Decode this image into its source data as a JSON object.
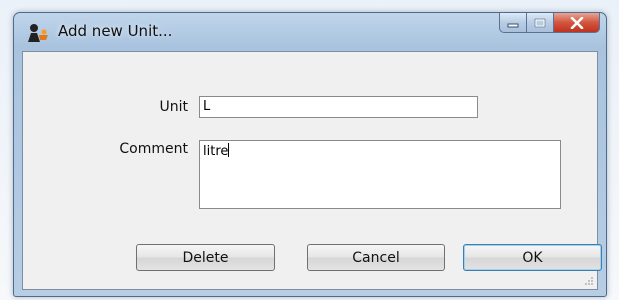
{
  "window": {
    "title": "Add new Unit..."
  },
  "form": {
    "unit_label": "Unit",
    "unit_value": "L",
    "comment_label": "Comment",
    "comment_value": "litre"
  },
  "buttons": {
    "delete_label": "Delete",
    "cancel_label": "Cancel",
    "ok_label": "OK"
  },
  "colors": {
    "close_button": "#c0321f",
    "default_button_border": "#3c7fb1"
  }
}
